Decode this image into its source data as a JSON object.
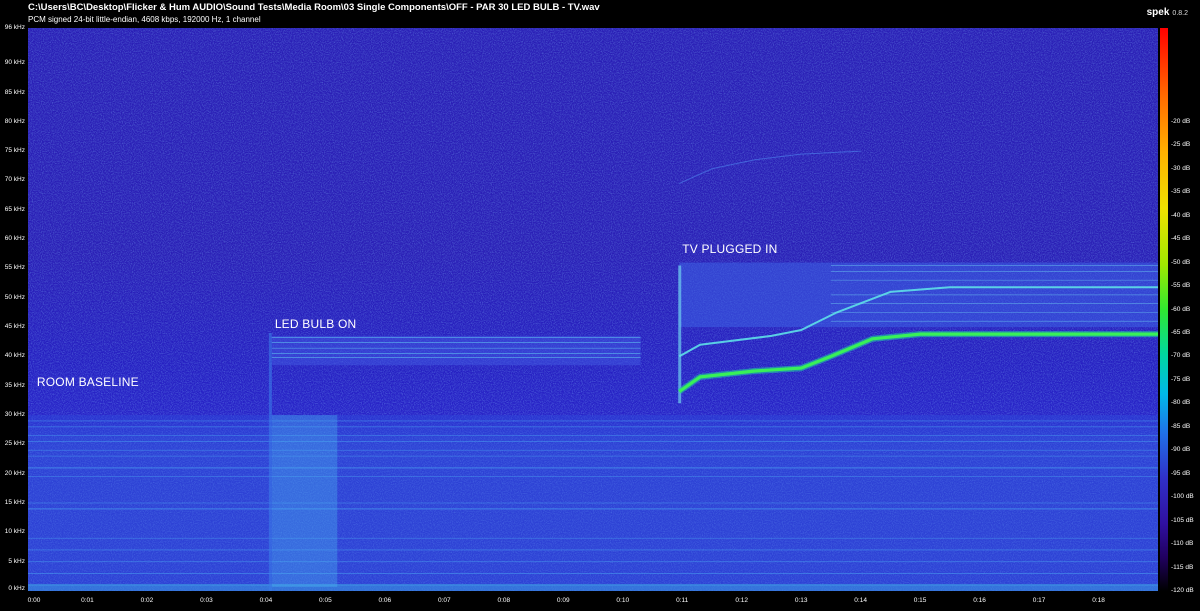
{
  "header": {
    "title": "C:\\Users\\BC\\Desktop\\Flicker & Hum AUDIO\\Sound Tests\\Media Room\\03 Single Components\\OFF - PAR 30 LED BULB - TV.wav",
    "info": "PCM signed 24-bit little-endian, 4608 kbps, 192000 Hz, 1 channel"
  },
  "app": {
    "name": "spek",
    "version": "0.8.2"
  },
  "chart_data": {
    "type": "heatmap",
    "xlabel": "",
    "ylabel": "",
    "xlim": [
      0,
      19
    ],
    "ylim": [
      0,
      96
    ],
    "x_ticks": [
      "0:00",
      "0:01",
      "0:02",
      "0:03",
      "0:04",
      "0:05",
      "0:06",
      "0:07",
      "0:08",
      "0:09",
      "0:10",
      "0:11",
      "0:12",
      "0:13",
      "0:14",
      "0:15",
      "0:16",
      "0:17",
      "0:18"
    ],
    "y_ticks": [
      "0 kHz",
      "5 kHz",
      "10 kHz",
      "15 kHz",
      "20 kHz",
      "25 kHz",
      "30 kHz",
      "35 kHz",
      "40 kHz",
      "45 kHz",
      "50 kHz",
      "55 kHz",
      "60 kHz",
      "65 kHz",
      "70 kHz",
      "75 kHz",
      "80 kHz",
      "85 kHz",
      "90 kHz",
      "96 kHz"
    ],
    "y_tick_values": [
      0,
      5,
      10,
      15,
      20,
      25,
      30,
      35,
      40,
      45,
      50,
      55,
      60,
      65,
      70,
      75,
      80,
      85,
      90,
      96
    ],
    "colorbar": {
      "range_db": [
        -120,
        0
      ],
      "ticks": [
        "-20 dB",
        "-25 dB",
        "-30 dB",
        "-35 dB",
        "-40 dB",
        "-45 dB",
        "-50 dB",
        "-55 dB",
        "-60 dB",
        "-65 dB",
        "-70 dB",
        "-75 dB",
        "-80 dB",
        "-85 dB",
        "-90 dB",
        "-95 dB",
        "-100 dB",
        "-105 dB",
        "-110 dB",
        "-115 dB",
        "-120 dB"
      ],
      "tick_values": [
        -20,
        -25,
        -30,
        -35,
        -40,
        -45,
        -50,
        -55,
        -60,
        -65,
        -70,
        -75,
        -80,
        -85,
        -90,
        -95,
        -100,
        -105,
        -110,
        -115,
        -120
      ]
    },
    "annotations": [
      {
        "text": "ROOM BASELINE",
        "time_s": 0.15,
        "freq_khz": 35.5
      },
      {
        "text": "LED BULB ON",
        "time_s": 4.15,
        "freq_khz": 45.3
      },
      {
        "text": "TV PLUGGED IN",
        "time_s": 11.0,
        "freq_khz": 58.2
      }
    ],
    "features": [
      {
        "name": "noise floor",
        "t_start": 0,
        "t_end": 19,
        "f_max_khz": 30
      },
      {
        "name": "bulb band",
        "t_start": 4.1,
        "t_end": 10.3,
        "f_low_khz": 38.5,
        "f_high_khz": 43.5
      },
      {
        "name": "tv hum",
        "t_start": 10.95,
        "t_end": 19,
        "freq_path_khz": [
          [
            10.95,
            34
          ],
          [
            11.3,
            36.5
          ],
          [
            12.2,
            37.5
          ],
          [
            13.0,
            38
          ],
          [
            13.5,
            40
          ],
          [
            14.2,
            43
          ],
          [
            15.0,
            43.8
          ],
          [
            19,
            43.8
          ]
        ]
      },
      {
        "name": "tv harmonic",
        "t_start": 10.95,
        "t_end": 19,
        "freq_path_khz": [
          [
            10.95,
            40
          ],
          [
            11.3,
            42
          ],
          [
            12.5,
            43.5
          ],
          [
            13.0,
            44.5
          ],
          [
            13.6,
            47.5
          ],
          [
            14.5,
            51
          ],
          [
            15.5,
            51.8
          ],
          [
            19,
            51.8
          ]
        ]
      },
      {
        "name": "tv band",
        "t_start": 10.95,
        "t_end": 19,
        "f_low_khz": 45,
        "f_high_khz": 56
      }
    ]
  }
}
